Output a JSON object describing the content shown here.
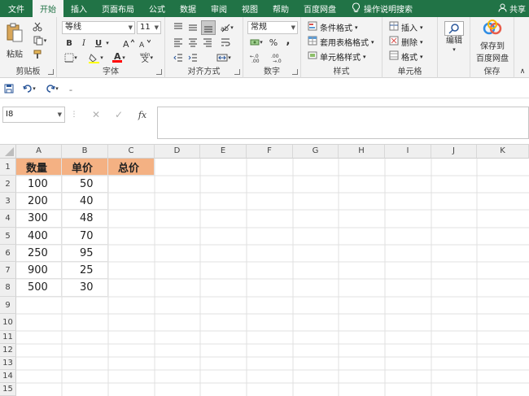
{
  "tabs": [
    "文件",
    "开始",
    "插入",
    "页面布局",
    "公式",
    "数据",
    "审阅",
    "视图",
    "帮助",
    "百度网盘"
  ],
  "active_tab_index": 1,
  "tell_me": "操作说明搜索",
  "share": "共享",
  "ribbon": {
    "clipboard": {
      "paste": "粘贴",
      "label": "剪贴板"
    },
    "font": {
      "name": "等线",
      "size": "11",
      "bold": "B",
      "italic": "I",
      "underline": "U",
      "label": "字体",
      "font_color_glyph": "A",
      "wen": "wén"
    },
    "alignment": {
      "label": "对齐方式"
    },
    "number": {
      "format": "常规",
      "percent": "%",
      "comma": ",",
      "label": "数字"
    },
    "styles": {
      "conditional": "条件格式",
      "table": "套用表格格式",
      "cell": "单元格样式",
      "label": "样式"
    },
    "cells": {
      "insert": "插入",
      "delete": "删除",
      "format": "格式",
      "label": "单元格"
    },
    "editing": {
      "edit": "编辑"
    },
    "save": {
      "line1": "保存到",
      "line2": "百度网盘",
      "label": "保存"
    }
  },
  "namebox": "I8",
  "fx": "fx",
  "columns": [
    "A",
    "B",
    "C",
    "D",
    "E",
    "F",
    "G",
    "H",
    "I",
    "J",
    "K"
  ],
  "rows": [
    "1",
    "2",
    "3",
    "4",
    "5",
    "6",
    "7",
    "8",
    "9",
    "10",
    "11",
    "12",
    "13",
    "14",
    "15"
  ],
  "table": {
    "headers": [
      "数量",
      "单价",
      "总价"
    ],
    "data": [
      [
        "100",
        "50"
      ],
      [
        "200",
        "40"
      ],
      [
        "300",
        "48"
      ],
      [
        "400",
        "70"
      ],
      [
        "250",
        "95"
      ],
      [
        "900",
        "25"
      ],
      [
        "500",
        "30"
      ]
    ]
  },
  "colors": {
    "brand": "#217346",
    "header_fill": "#f4b183"
  }
}
